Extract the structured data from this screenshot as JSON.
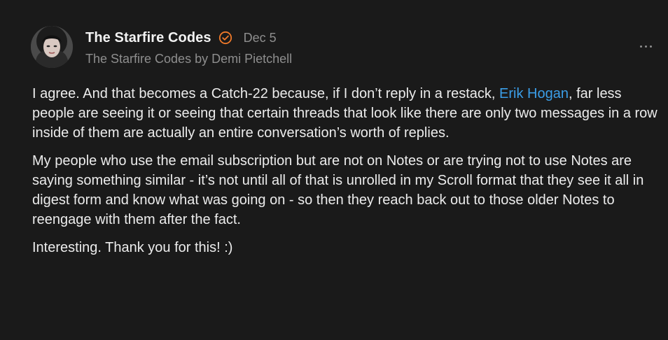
{
  "author": {
    "name": "The Starfire Codes",
    "date": "Dec 5",
    "publication": "The Starfire Codes by Demi Pietchell",
    "verified_color": "#f07a2a"
  },
  "post": {
    "p1_before": "I agree. And that becomes a Catch-22 because, if I don’t reply in a restack, ",
    "mention": "Erik Hogan",
    "p1_after": ", far less people are seeing it or seeing that certain threads that look like there are only two messages in a row inside of them are actually an entire conversation’s worth of replies.",
    "p2": "My people who use the email subscription but are not on Notes or are trying not to use Notes are saying something similar - it’s not until all of that is unrolled in my Scroll format that they see it all in digest form and know what was going on - so then they reach back out to those older Notes to reengage with them after the fact.",
    "p3": "Interesting. Thank you for this! :)"
  },
  "icons": {
    "more": "more-horizontal-icon",
    "verified": "verified-badge-icon"
  },
  "colors": {
    "background": "#1a1a1a",
    "text": "#ececec",
    "muted": "#8e8e8e",
    "link": "#3b9ee8"
  }
}
